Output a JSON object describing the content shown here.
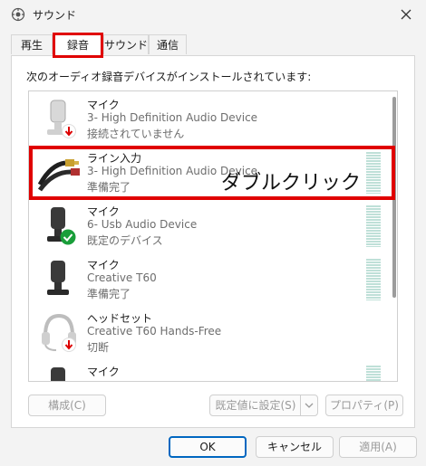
{
  "window": {
    "title": "サウンド"
  },
  "tabs": [
    {
      "label": "再生"
    },
    {
      "label": "録音"
    },
    {
      "label": "サウンド"
    },
    {
      "label": "通信"
    }
  ],
  "caption": "次のオーディオ録音デバイスがインストールされています:",
  "devices": [
    {
      "name": "マイク",
      "desc": "3- High Definition Audio Device",
      "status": "接続されていません",
      "icon": "microphone-icon",
      "badge": "red-down-arrow-badge"
    },
    {
      "name": "ライン入力",
      "desc": "3- High Definition Audio Device",
      "status": "準備完了",
      "icon": "line-in-cable-icon"
    },
    {
      "name": "マイク",
      "desc": "6- Usb Audio Device",
      "status": "既定のデバイス",
      "icon": "microphone-icon",
      "badge": "green-check-badge"
    },
    {
      "name": "マイク",
      "desc": "Creative T60",
      "status": "準備完了",
      "icon": "microphone-icon"
    },
    {
      "name": "ヘッドセット",
      "desc": "Creative T60 Hands-Free",
      "status": "切断",
      "icon": "headset-icon",
      "badge": "red-down-arrow-badge"
    },
    {
      "name": "マイク",
      "icon": "microphone-icon"
    }
  ],
  "annotation": "ダブルクリック",
  "buttons": {
    "configure": "構成(C)",
    "set_default": "既定値に設定(S)",
    "properties": "プロパティ(P)",
    "ok": "OK",
    "cancel": "キャンセル",
    "apply": "適用(A)"
  },
  "colors": {
    "highlight": "#e00000",
    "accent": "#0067c0",
    "check": "#1a9e3a"
  }
}
